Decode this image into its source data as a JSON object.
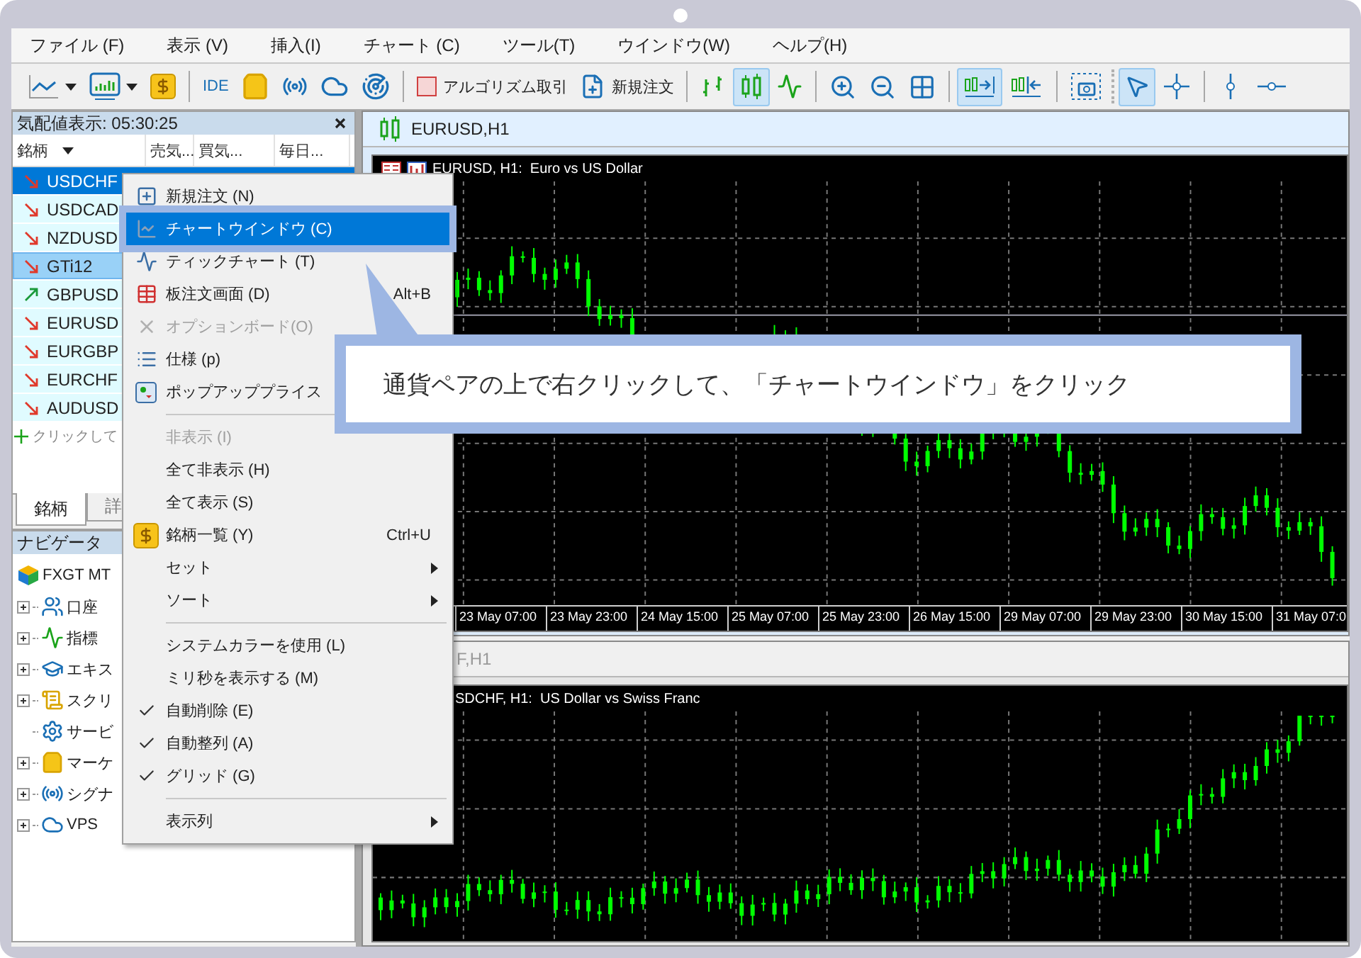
{
  "menubar": [
    "ファイル (F)",
    "表示 (V)",
    "挿入(I)",
    "チャート (C)",
    "ツール(T)",
    "ウインドウ(W)",
    "ヘルプ(H)"
  ],
  "toolbar": [
    {
      "kind": "dropdown",
      "selected": false
    },
    {
      "kind": "dropdown",
      "selected": false
    },
    {
      "kind": "button",
      "selected": false
    },
    {
      "kind": "separator"
    },
    {
      "kind": "text",
      "label": "IDE",
      "selected": false
    },
    {
      "kind": "button",
      "selected": false
    },
    {
      "kind": "button",
      "selected": false
    },
    {
      "kind": "button",
      "selected": false
    },
    {
      "kind": "button",
      "selected": false
    },
    {
      "kind": "separator"
    },
    {
      "kind": "icon_text",
      "label": "アルゴリズム取引",
      "selected": false
    },
    {
      "kind": "icon_text",
      "label": "新規注文",
      "selected": false
    },
    {
      "kind": "separator"
    },
    {
      "kind": "button",
      "selected": false
    },
    {
      "kind": "button",
      "selected": true
    },
    {
      "kind": "button",
      "selected": false
    },
    {
      "kind": "separator"
    },
    {
      "kind": "button",
      "selected": false
    },
    {
      "kind": "button",
      "selected": false
    },
    {
      "kind": "button",
      "selected": false
    },
    {
      "kind": "separator"
    },
    {
      "kind": "button",
      "selected": true
    },
    {
      "kind": "button",
      "selected": false
    },
    {
      "kind": "separator"
    },
    {
      "kind": "button",
      "selected": false
    },
    {
      "kind": "grip"
    },
    {
      "kind": "button",
      "selected": true
    },
    {
      "kind": "button",
      "selected": false
    },
    {
      "kind": "separator"
    },
    {
      "kind": "button",
      "selected": false
    },
    {
      "kind": "button",
      "selected": false
    }
  ],
  "market_watch": {
    "title": "気配値表示: 05:30:25",
    "columns": [
      "銘柄",
      "売気...",
      "買気...",
      "毎日..."
    ],
    "rows": [
      {
        "symbol": "USDCHF",
        "rising": false,
        "selected": true,
        "hovered": false
      },
      {
        "symbol": "USDCAD",
        "rising": false,
        "selected": false,
        "hovered": false
      },
      {
        "symbol": "NZDUSD",
        "rising": false,
        "selected": false,
        "hovered": false
      },
      {
        "symbol": "GTi12",
        "rising": false,
        "selected": false,
        "hovered": true
      },
      {
        "symbol": "GBPUSD",
        "rising": true,
        "selected": false,
        "hovered": false
      },
      {
        "symbol": "EURUSD",
        "rising": false,
        "selected": false,
        "hovered": false
      },
      {
        "symbol": "EURGBP",
        "rising": false,
        "selected": false,
        "hovered": false
      },
      {
        "symbol": "EURCHF",
        "rising": false,
        "selected": false,
        "hovered": false
      },
      {
        "symbol": "AUDUSD",
        "rising": false,
        "selected": false,
        "hovered": false
      }
    ],
    "add_row": "クリックして",
    "tabs": [
      {
        "label": "銘柄",
        "selected": true
      },
      {
        "label": "詳",
        "selected": false
      }
    ]
  },
  "navigator": {
    "title": "ナビゲータ",
    "root": "FXGT MT",
    "children": [
      {
        "label": "口座",
        "expandable": true
      },
      {
        "label": "指標",
        "expandable": true
      },
      {
        "label": "エキス",
        "expandable": true
      },
      {
        "label": "スクリ",
        "expandable": true
      },
      {
        "label": "サービ",
        "expandable": false
      },
      {
        "label": "マーケ",
        "expandable": true
      },
      {
        "label": "シグナ",
        "expandable": true
      },
      {
        "label": "VPS",
        "expandable": true
      }
    ]
  },
  "charts": [
    {
      "title": "EURUSD,H1",
      "active": true,
      "label": "EURUSD, H1:  Euro vs US Dollar",
      "time_axis": [
        "23 May 07:00",
        "23 May 23:00",
        "24 May 15:00",
        "25 May 07:00",
        "25 May 23:00",
        "26 May 15:00",
        "29 May 07:00",
        "29 May 23:00",
        "30 May 15:00",
        "31 May 07:0"
      ]
    },
    {
      "title": "F,H1",
      "active": false,
      "label": "SDCHF, H1:  US Dollar vs Swiss Franc"
    }
  ],
  "context_menu": [
    {
      "kind": "item",
      "label": "新規注文 (N)",
      "selected": false,
      "disabled": false,
      "checked": false,
      "submenu": false
    },
    {
      "kind": "item",
      "label": "チャートウインドウ (C)",
      "selected": true,
      "disabled": false,
      "checked": false,
      "submenu": false
    },
    {
      "kind": "item",
      "label": "ティックチャート (T)",
      "selected": false,
      "disabled": false,
      "checked": false,
      "submenu": false
    },
    {
      "kind": "item",
      "label": "板注文画面 (D)",
      "shortcut": "Alt+B",
      "selected": false,
      "disabled": false,
      "checked": false,
      "submenu": false
    },
    {
      "kind": "item",
      "label": "オプションボード(O)",
      "selected": false,
      "disabled": true,
      "checked": false,
      "submenu": false
    },
    {
      "kind": "item",
      "label": "仕様 (p)",
      "selected": false,
      "disabled": false,
      "checked": false
    },
    {
      "kind": "item",
      "label": "ポップアッププライス",
      "selected": false,
      "disabled": false,
      "checked": false
    },
    {
      "kind": "separator"
    },
    {
      "kind": "item",
      "label": "非表示 (I)",
      "selected": false,
      "disabled": true,
      "checked": false,
      "submenu": false
    },
    {
      "kind": "item",
      "label": "全て非表示 (H)",
      "selected": false,
      "disabled": false,
      "checked": false,
      "submenu": false
    },
    {
      "kind": "item",
      "label": "全て表示 (S)",
      "selected": false,
      "disabled": false,
      "checked": false,
      "submenu": false
    },
    {
      "kind": "item",
      "label": "銘柄一覧 (Y)",
      "shortcut": "Ctrl+U",
      "selected": false,
      "disabled": false,
      "checked": false,
      "submenu": false
    },
    {
      "kind": "item",
      "label": "セット",
      "selected": false,
      "disabled": false,
      "checked": false,
      "submenu": true
    },
    {
      "kind": "item",
      "label": "ソート",
      "selected": false,
      "disabled": false,
      "checked": false,
      "submenu": true
    },
    {
      "kind": "separator"
    },
    {
      "kind": "item",
      "label": "システムカラーを使用 (L)",
      "selected": false,
      "disabled": false,
      "checked": false,
      "submenu": false
    },
    {
      "kind": "item",
      "label": "ミリ秒を表示する (M)",
      "selected": false,
      "disabled": false,
      "checked": false,
      "submenu": false
    },
    {
      "kind": "item",
      "label": "自動削除 (E)",
      "selected": false,
      "disabled": false,
      "checked": true,
      "submenu": false
    },
    {
      "kind": "item",
      "label": "自動整列 (A)",
      "selected": false,
      "disabled": false,
      "checked": true,
      "submenu": false
    },
    {
      "kind": "item",
      "label": "グリッド (G)",
      "selected": false,
      "disabled": false,
      "checked": true,
      "submenu": false
    },
    {
      "kind": "separator"
    },
    {
      "kind": "item",
      "label": "表示列",
      "selected": false,
      "disabled": false,
      "checked": false,
      "submenu": true
    }
  ],
  "callout": {
    "text": "通貨ペアの上で右クリックして、「チャートウインドウ」をクリック"
  }
}
